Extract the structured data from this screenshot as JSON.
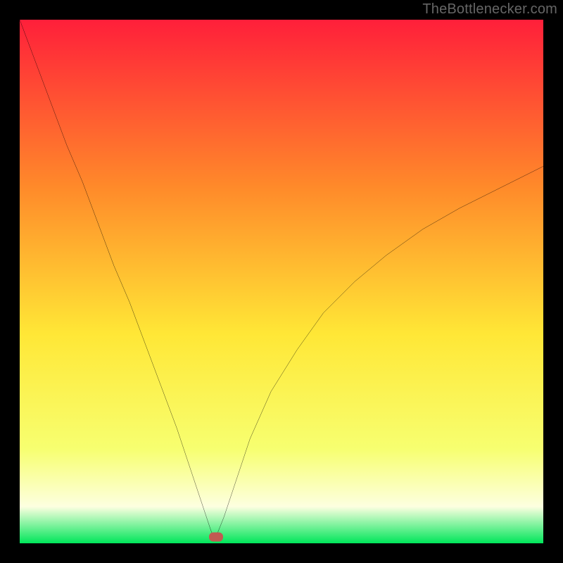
{
  "watermark": "TheBottlenecker.com",
  "gradient": {
    "top": "#ff1f3a",
    "upper_mid": "#ff8a2a",
    "mid": "#ffe736",
    "lower_mid": "#f7ff70",
    "pale": "#fdffe0",
    "green": "#00e65a"
  },
  "plot": {
    "width_units": 100,
    "height_units": 100,
    "minimum_x": 37,
    "minimum_y": 98.5,
    "marker": {
      "x_pct": 37.5,
      "y_pct": 98.8
    }
  },
  "chart_data": {
    "type": "line",
    "title": "",
    "xlabel": "",
    "ylabel": "",
    "xlim": [
      0,
      100
    ],
    "ylim": [
      0,
      100
    ],
    "note": "Bottleneck-style V curve: y ≈ 100 at x=0, drops to ≈1 near x≈37 (minimum), rises to ≈72 at x=100. Background is a vertical heat gradient red→yellow→green from top to bottom. A small rounded marker sits at the curve's minimum.",
    "series": [
      {
        "name": "bottleneck-curve",
        "x": [
          0,
          3,
          6,
          9,
          12,
          15,
          18,
          21,
          24,
          27,
          30,
          32,
          34,
          35.5,
          36.5,
          37,
          37.8,
          39,
          41,
          44,
          48,
          53,
          58,
          64,
          70,
          77,
          84,
          92,
          100
        ],
        "y": [
          100,
          92,
          84,
          76,
          69,
          61,
          53,
          46,
          38,
          30,
          22,
          16,
          10,
          5.5,
          2.5,
          1.3,
          2.0,
          5,
          11,
          20,
          29,
          37,
          44,
          50,
          55,
          60,
          64,
          68,
          72
        ]
      }
    ],
    "marker": {
      "x": 37.5,
      "y": 1.2
    }
  }
}
